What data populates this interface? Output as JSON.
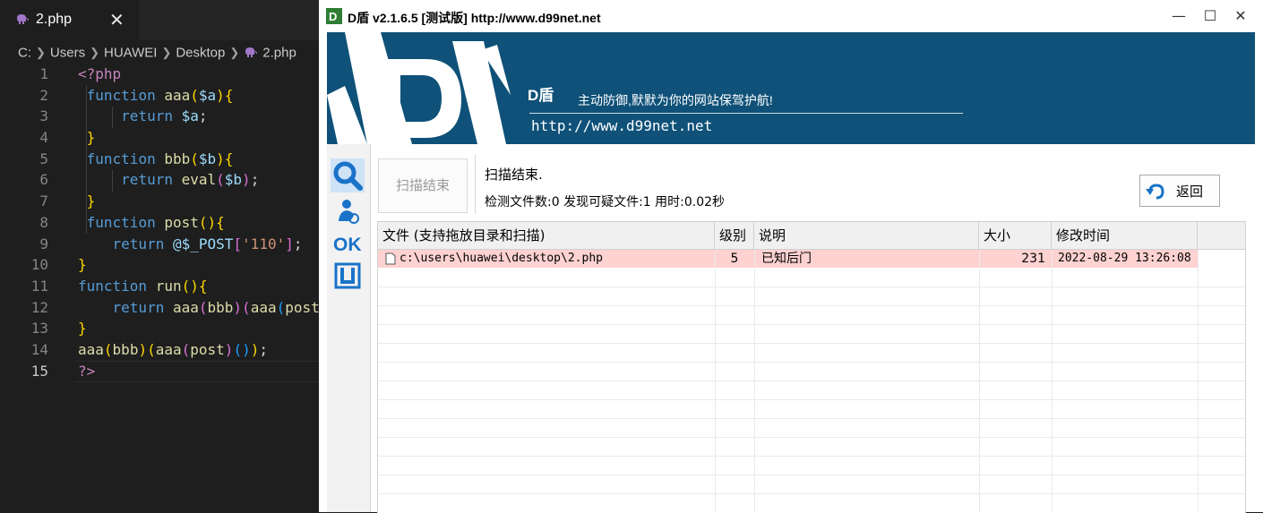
{
  "editor": {
    "tab": {
      "filename": "2.php",
      "close_glyph": "✕"
    },
    "breadcrumb": [
      "C:",
      "Users",
      "HUAWEI",
      "Desktop",
      "2.php"
    ],
    "active_line": 15,
    "lines": [
      {
        "n": "1"
      },
      {
        "n": "2"
      },
      {
        "n": "3"
      },
      {
        "n": "4"
      },
      {
        "n": "5"
      },
      {
        "n": "6"
      },
      {
        "n": "7"
      },
      {
        "n": "8"
      },
      {
        "n": "9"
      },
      {
        "n": "10"
      },
      {
        "n": "11"
      },
      {
        "n": "12"
      },
      {
        "n": "13"
      },
      {
        "n": "14"
      },
      {
        "n": "15"
      }
    ],
    "tokens": {
      "open": "<?php",
      "kw_function": "function",
      "kw_return": "return",
      "fn_aaa": "aaa",
      "fn_bbb": "bbb",
      "fn_post": "post",
      "fn_run": "run",
      "fn_eval": "eval",
      "var_a": "$a",
      "var_b": "$b",
      "at_post": "@$_POST",
      "str_110": "'110'",
      "close": "?>"
    },
    "colors": {
      "background": "#1e1e1e",
      "keyword": "#569cd6",
      "function": "#dcdcaa",
      "variable": "#9cdcfe",
      "string": "#ce9178"
    }
  },
  "dshield": {
    "title": "D盾 v2.1.6.5 [测试版] http://www.d99net.net",
    "window_buttons": {
      "minimize": "—",
      "maximize": "☐",
      "close": "✕"
    },
    "banner": {
      "brand": "D盾",
      "slogan": "主动防御,默默为你的网站保驾护航!",
      "url": "http://www.d99net.net",
      "color": "#0f5178"
    },
    "sidebar_icons": [
      "search-icon",
      "user-scan-icon",
      "ok-icon",
      "shield-icon"
    ],
    "toolbar": {
      "scan_button": "扫描结束",
      "status_line1": "扫描结束.",
      "status_line2": "检测文件数:0 发现可疑文件:1 用时:0.02秒",
      "back_button": "返回"
    },
    "table": {
      "columns": [
        "文件 (支持拖放目录和扫描)",
        "级别",
        "说明",
        "大小",
        "修改时间"
      ],
      "rows": [
        {
          "file": "c:\\users\\huawei\\desktop\\2.php",
          "level": "5",
          "desc": "已知后门",
          "size": "231",
          "mtime": "2022-08-29 13:26:08",
          "highlight": "#ffd2d2"
        }
      ]
    }
  }
}
